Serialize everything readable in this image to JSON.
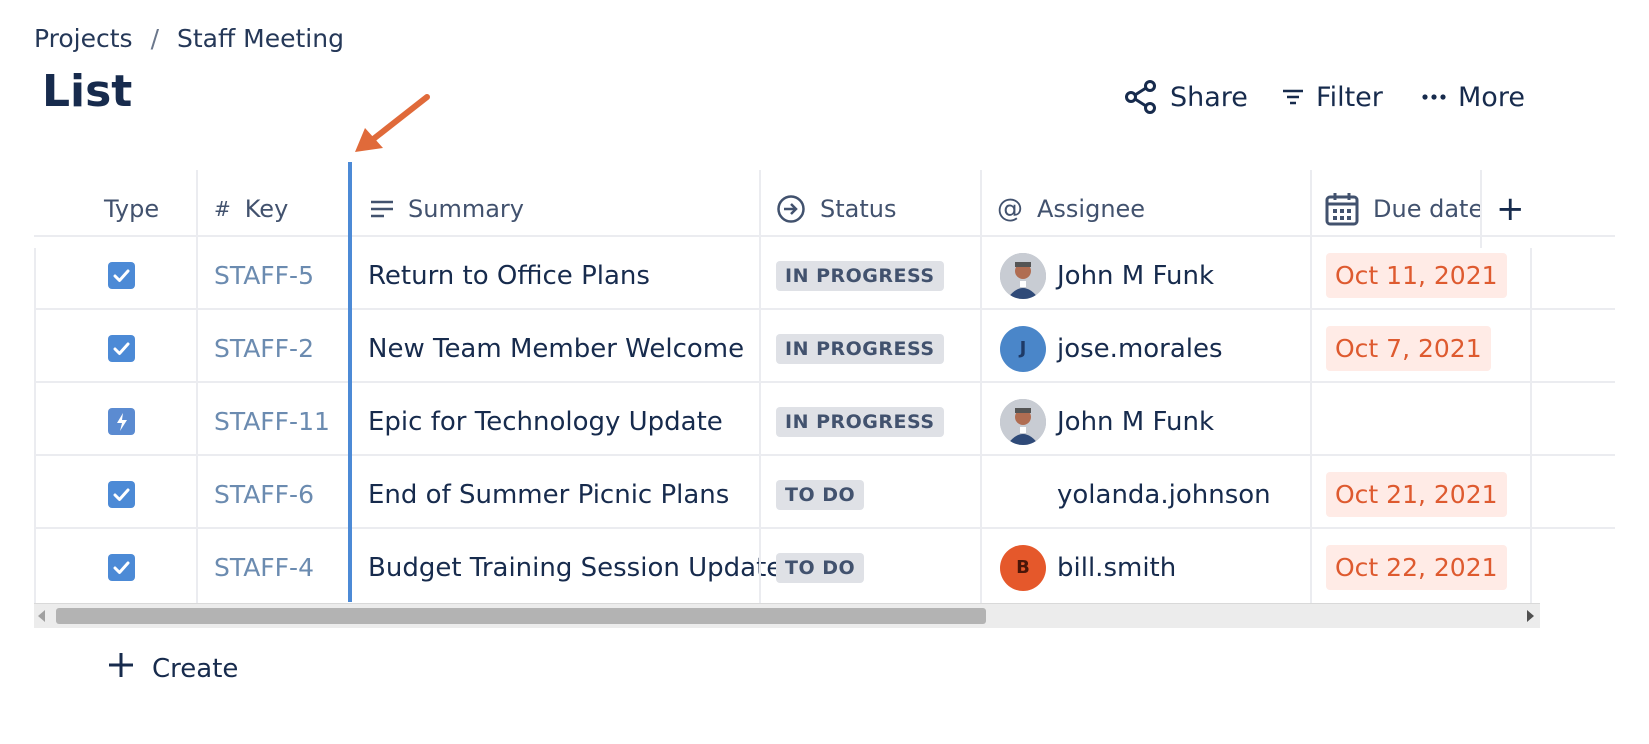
{
  "breadcrumb": {
    "root": "Projects",
    "separator": "/",
    "current": "Staff Meeting"
  },
  "page_title": "List",
  "toolbar": {
    "share": "Share",
    "filter": "Filter",
    "more": "More"
  },
  "columns": {
    "type": "Type",
    "key_prefix": "#",
    "key": "Key",
    "summary": "Summary",
    "status": "Status",
    "assignee_prefix": "@",
    "assignee": "Assignee",
    "due_date": "Due date",
    "add_column": "+"
  },
  "rows": [
    {
      "type": "task",
      "key": "STAFF-5",
      "summary": "Return to Office Plans",
      "status": "IN PROGRESS",
      "assignee": "John M Funk",
      "avatar": "photo",
      "due": "Oct 11, 2021"
    },
    {
      "type": "task",
      "key": "STAFF-2",
      "summary": "New Team Member Welcome",
      "status": "IN PROGRESS",
      "assignee": "jose.morales",
      "avatar_initial": "J",
      "due": "Oct 7, 2021"
    },
    {
      "type": "epic",
      "key": "STAFF-11",
      "summary": "Epic for Technology Update",
      "status": "IN PROGRESS",
      "assignee": "John M Funk",
      "avatar": "photo",
      "due": ""
    },
    {
      "type": "task",
      "key": "STAFF-6",
      "summary": "End of Summer Picnic Plans",
      "status": "TO DO",
      "assignee": "yolanda.johnson",
      "avatar": "none",
      "due": "Oct 21, 2021"
    },
    {
      "type": "task",
      "key": "STAFF-4",
      "summary": "Budget Training Session Update",
      "status": "TO DO",
      "assignee": "bill.smith",
      "avatar_initial": "B",
      "due": "Oct 22, 2021"
    }
  ],
  "create": {
    "icon": "+",
    "label": "Create"
  },
  "colors": {
    "accent": "#4c8ad6",
    "due_bg": "#ffebe6",
    "due_text": "#de5a2f",
    "annotation_arrow": "#e06a3a"
  }
}
